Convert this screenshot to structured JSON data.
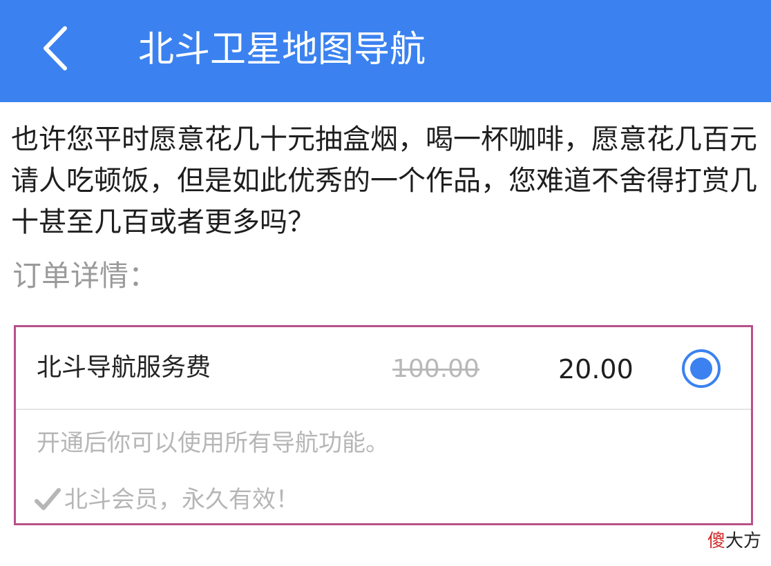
{
  "header": {
    "title": "北斗卫星地图导航",
    "back_icon": "chevron-left-icon",
    "background_color": "#3b82f0"
  },
  "intro_text": "也许您平时愿意花几十元抽盒烟，喝一杯咖啡，愿意花几百元请人吃顿饭，但是如此优秀的一个作品，您难道不舍得打赏几十甚至几百或者更多吗？",
  "order_section_label": "订单详情：",
  "order": {
    "item_name": "北斗导航服务费",
    "original_price": "100.00",
    "sale_price": "20.00",
    "selected": true,
    "description": "开通后你可以使用所有导航功能。",
    "member_note": "北斗会员，永久有效！",
    "member_icon": "checkmark-icon",
    "border_color": "#b85088"
  },
  "watermark": {
    "accent_char": "傻",
    "rest": "大方"
  }
}
